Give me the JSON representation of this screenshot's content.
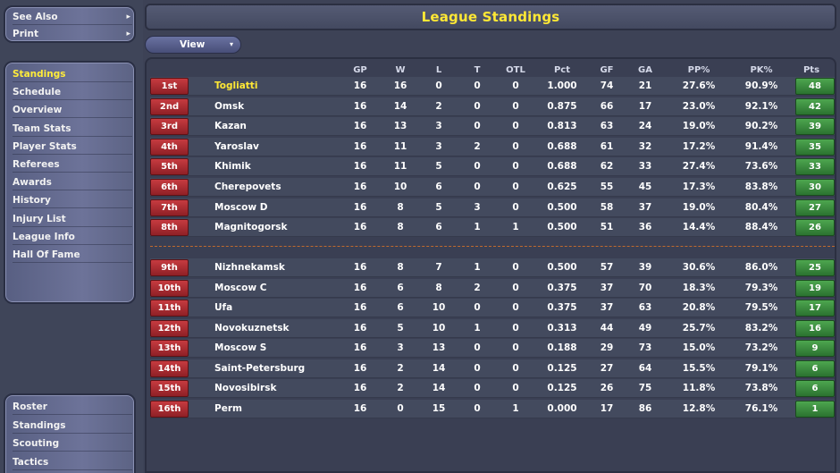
{
  "sidebar_top": {
    "items": [
      {
        "label": "See Also",
        "arrow": "▸"
      },
      {
        "label": "Print",
        "arrow": "▸"
      }
    ]
  },
  "sidebar_nav": {
    "items": [
      {
        "label": "Standings",
        "active": true
      },
      {
        "label": "Schedule"
      },
      {
        "label": "Overview"
      },
      {
        "label": "Team Stats"
      },
      {
        "label": "Player Stats"
      },
      {
        "label": "Referees"
      },
      {
        "label": "Awards"
      },
      {
        "label": "History"
      },
      {
        "label": "Injury List"
      },
      {
        "label": "League Info"
      },
      {
        "label": "Hall Of Fame"
      }
    ]
  },
  "sidebar_bottom": {
    "items": [
      {
        "label": "Roster"
      },
      {
        "label": "Standings"
      },
      {
        "label": "Scouting"
      },
      {
        "label": "Tactics"
      }
    ]
  },
  "header": {
    "title": "League Standings"
  },
  "toolbar": {
    "view_label": "View",
    "view_caret": "▾"
  },
  "table": {
    "columns": [
      "GP",
      "W",
      "L",
      "T",
      "OTL",
      "Pct",
      "GF",
      "GA",
      "PP%",
      "PK%",
      "Pts"
    ],
    "rows": [
      {
        "rank": "1st",
        "team": "Togliatti",
        "gp": "16",
        "w": "16",
        "l": "0",
        "t": "0",
        "otl": "0",
        "pct": "1.000",
        "gf": "74",
        "ga": "21",
        "pp": "27.6%",
        "pk": "90.9%",
        "pts": "48"
      },
      {
        "rank": "2nd",
        "team": "Omsk",
        "gp": "16",
        "w": "14",
        "l": "2",
        "t": "0",
        "otl": "0",
        "pct": "0.875",
        "gf": "66",
        "ga": "17",
        "pp": "23.0%",
        "pk": "92.1%",
        "pts": "42"
      },
      {
        "rank": "3rd",
        "team": "Kazan",
        "gp": "16",
        "w": "13",
        "l": "3",
        "t": "0",
        "otl": "0",
        "pct": "0.813",
        "gf": "63",
        "ga": "24",
        "pp": "19.0%",
        "pk": "90.2%",
        "pts": "39"
      },
      {
        "rank": "4th",
        "team": "Yaroslav",
        "gp": "16",
        "w": "11",
        "l": "3",
        "t": "2",
        "otl": "0",
        "pct": "0.688",
        "gf": "61",
        "ga": "32",
        "pp": "17.2%",
        "pk": "91.4%",
        "pts": "35"
      },
      {
        "rank": "5th",
        "team": "Khimik",
        "gp": "16",
        "w": "11",
        "l": "5",
        "t": "0",
        "otl": "0",
        "pct": "0.688",
        "gf": "62",
        "ga": "33",
        "pp": "27.4%",
        "pk": "73.6%",
        "pts": "33"
      },
      {
        "rank": "6th",
        "team": "Cherepovets",
        "gp": "16",
        "w": "10",
        "l": "6",
        "t": "0",
        "otl": "0",
        "pct": "0.625",
        "gf": "55",
        "ga": "45",
        "pp": "17.3%",
        "pk": "83.8%",
        "pts": "30"
      },
      {
        "rank": "7th",
        "team": "Moscow D",
        "gp": "16",
        "w": "8",
        "l": "5",
        "t": "3",
        "otl": "0",
        "pct": "0.500",
        "gf": "58",
        "ga": "37",
        "pp": "19.0%",
        "pk": "80.4%",
        "pts": "27"
      },
      {
        "rank": "8th",
        "team": "Magnitogorsk",
        "gp": "16",
        "w": "8",
        "l": "6",
        "t": "1",
        "otl": "1",
        "pct": "0.500",
        "gf": "51",
        "ga": "36",
        "pp": "14.4%",
        "pk": "88.4%",
        "pts": "26"
      },
      {
        "rank": "9th",
        "team": "Nizhnekamsk",
        "gp": "16",
        "w": "8",
        "l": "7",
        "t": "1",
        "otl": "0",
        "pct": "0.500",
        "gf": "57",
        "ga": "39",
        "pp": "30.6%",
        "pk": "86.0%",
        "pts": "25"
      },
      {
        "rank": "10th",
        "team": "Moscow C",
        "gp": "16",
        "w": "6",
        "l": "8",
        "t": "2",
        "otl": "0",
        "pct": "0.375",
        "gf": "37",
        "ga": "70",
        "pp": "18.3%",
        "pk": "79.3%",
        "pts": "19"
      },
      {
        "rank": "11th",
        "team": "Ufa",
        "gp": "16",
        "w": "6",
        "l": "10",
        "t": "0",
        "otl": "0",
        "pct": "0.375",
        "gf": "37",
        "ga": "63",
        "pp": "20.8%",
        "pk": "79.5%",
        "pts": "17"
      },
      {
        "rank": "12th",
        "team": "Novokuznetsk",
        "gp": "16",
        "w": "5",
        "l": "10",
        "t": "1",
        "otl": "0",
        "pct": "0.313",
        "gf": "44",
        "ga": "49",
        "pp": "25.7%",
        "pk": "83.2%",
        "pts": "16"
      },
      {
        "rank": "13th",
        "team": "Moscow S",
        "gp": "16",
        "w": "3",
        "l": "13",
        "t": "0",
        "otl": "0",
        "pct": "0.188",
        "gf": "29",
        "ga": "73",
        "pp": "15.0%",
        "pk": "73.2%",
        "pts": "9"
      },
      {
        "rank": "14th",
        "team": "Saint-Petersburg",
        "gp": "16",
        "w": "2",
        "l": "14",
        "t": "0",
        "otl": "0",
        "pct": "0.125",
        "gf": "27",
        "ga": "64",
        "pp": "15.5%",
        "pk": "79.1%",
        "pts": "6"
      },
      {
        "rank": "15th",
        "team": "Novosibirsk",
        "gp": "16",
        "w": "2",
        "l": "14",
        "t": "0",
        "otl": "0",
        "pct": "0.125",
        "gf": "26",
        "ga": "75",
        "pp": "11.8%",
        "pk": "73.8%",
        "pts": "6"
      },
      {
        "rank": "16th",
        "team": "Perm",
        "gp": "16",
        "w": "0",
        "l": "15",
        "t": "0",
        "otl": "1",
        "pct": "0.000",
        "gf": "17",
        "ga": "86",
        "pp": "12.8%",
        "pk": "76.1%",
        "pts": "1"
      }
    ]
  },
  "colors": {
    "title": "#ffe835",
    "active_nav": "#ffec3a",
    "rank_badge": "#b3303a",
    "points_badge": "#3d9142",
    "divider": "#c06a2e"
  }
}
